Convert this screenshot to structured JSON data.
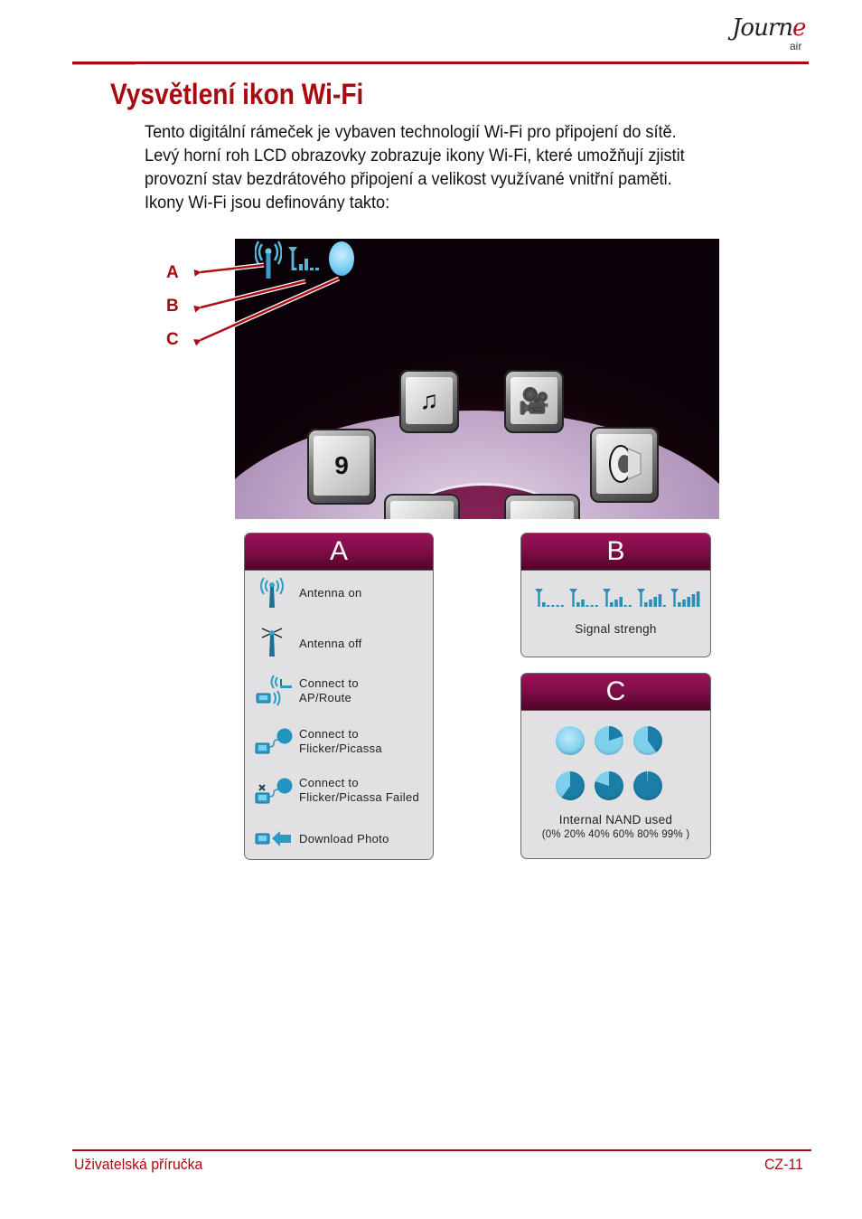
{
  "header": {
    "logo_script": "Journ",
    "logo_script_accent": "e",
    "logo_sub": "air"
  },
  "page": {
    "title": "Vysvětlení ikon Wi-Fi",
    "paragraph_lines": [
      "Tento digitální rámeček je vybaven technologií Wi-Fi pro připojení do sítě.",
      "Levý horní roh LCD obrazovky zobrazuje ikony Wi-Fi, které umožňují zjistit",
      "provozní stav bezdrátového připojení a velikost využívané vnitřní paměti.",
      "Ikony Wi-Fi jsou definovány takto:"
    ]
  },
  "figure": {
    "callouts": [
      "A",
      "B",
      "C"
    ],
    "lcd_status_icons": [
      "antenna-icon",
      "signal-strength-icon",
      "memory-usage-icon"
    ],
    "lcd_menu_tiles": [
      "photo-music-icon",
      "video-camera-icon",
      "calendar-icon",
      "speaker-icon",
      "settings-icon",
      "weather-icon"
    ],
    "calendar_tile_day": "9"
  },
  "panels": {
    "a": {
      "header": "A",
      "items": [
        {
          "icon": "antenna-on-icon",
          "lines": [
            "Antenna on"
          ]
        },
        {
          "icon": "antenna-off-icon",
          "lines": [
            "Antenna off"
          ]
        },
        {
          "icon": "router-connect-icon",
          "lines": [
            "Connect to",
            "AP/Route"
          ]
        },
        {
          "icon": "cloud-connect-icon",
          "lines": [
            "Connect to",
            "Flicker/Picassa"
          ]
        },
        {
          "icon": "cloud-connect-failed-icon",
          "lines": [
            "Connect to",
            "Flicker/Picassa Failed"
          ]
        },
        {
          "icon": "download-photo-icon",
          "lines": [
            "Download Photo"
          ]
        }
      ]
    },
    "b": {
      "header": "B",
      "signal_levels": [
        1,
        2,
        3,
        4,
        5
      ],
      "caption": "Signal strengh"
    },
    "c": {
      "header": "C",
      "nand_used_percent": [
        0,
        20,
        40,
        60,
        80,
        99
      ],
      "caption": "Internal NAND used",
      "caption_values": "(0% 20% 40% 60% 80% 99% )"
    }
  },
  "colors": {
    "brand_red": "#a70a10",
    "panel_header": "#7e0d47",
    "icon_blue": "#2a8fb5",
    "icon_light_blue": "#7fd0ee"
  },
  "footer": {
    "left": "Uživatelská příručka",
    "right": "CZ-11"
  }
}
